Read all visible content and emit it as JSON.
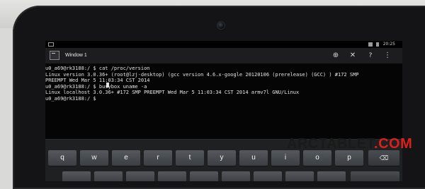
{
  "status_bar": {
    "time": "20:25"
  },
  "action_bar": {
    "window_title": "Window 1",
    "add_icon": "plus-circle-icon",
    "close_icon": "close-icon",
    "help_label": "?",
    "menu_icon": "overflow-menu-icon"
  },
  "terminal": {
    "lines": [
      "u0_a69@rk3188:/ $ cat /proc/version",
      "Linux version 3.0.36+ (root@lzj-desktop) (gcc version 4.6.x-google 20120106 (prerelease) (GCC) ) #172 SMP",
      "PREEMPT Wed Mar 5 11:03:34 CST 2014",
      "u0_a69@rk3188:/ $ busybox uname -a",
      "Linux localhost 3.0.36+ #172 SMP PREEMPT Wed Mar 5 11:03:34 CST 2014 armv7l GNU/Linux",
      "u0_a69@rk3188:/ $"
    ]
  },
  "keyboard": {
    "row1": [
      "q",
      "w",
      "e",
      "r",
      "t",
      "y",
      "u",
      "i",
      "o",
      "p"
    ],
    "delete_icon": "backspace-icon"
  },
  "watermark": {
    "part1": "ARCTABLET",
    "part2": ".COM"
  }
}
